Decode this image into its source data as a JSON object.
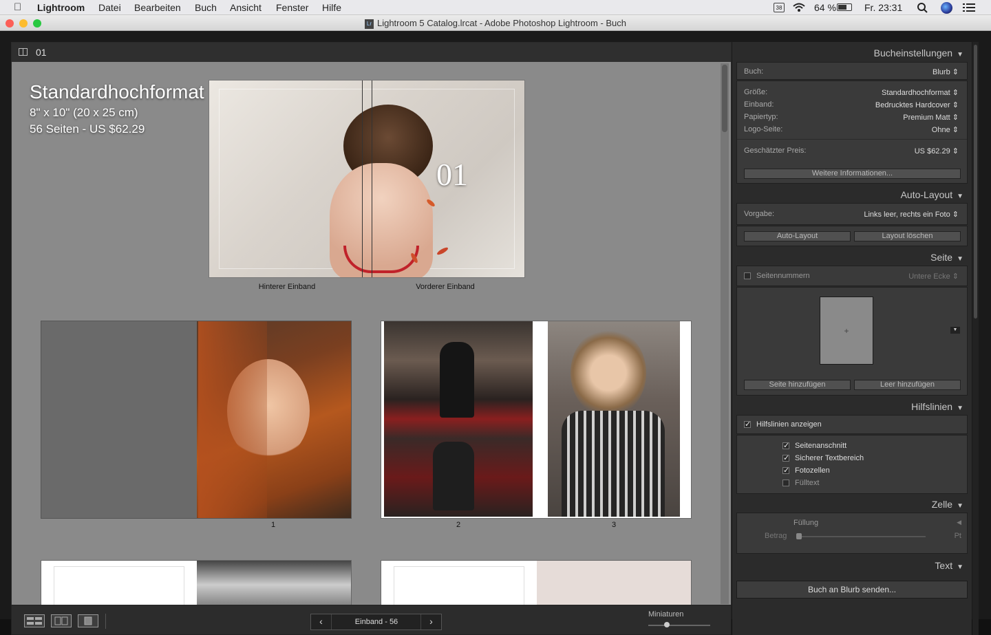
{
  "menubar": {
    "app": "Lightroom",
    "items": [
      "Datei",
      "Bearbeiten",
      "Buch",
      "Ansicht",
      "Fenster",
      "Hilfe"
    ],
    "calendar_day": "38",
    "battery": "64 %",
    "clock": "Fr. 23:31"
  },
  "window": {
    "title": "Lightroom 5 Catalog.lrcat - Adobe Photoshop Lightroom - Buch"
  },
  "canvas": {
    "header_page": "01",
    "overlay_title": "Standardhochformat",
    "overlay_size": "8\" x 10\" (20 x 25 cm)",
    "overlay_pages": "56 Seiten - US $62.29",
    "cover_number": "01",
    "back_cover_label": "Hinterer Einband",
    "front_cover_label": "Vorderer Einband",
    "page_labels": [
      "1",
      "2",
      "3"
    ]
  },
  "bottombar": {
    "nav_label": "Einband - 56",
    "thumb_label": "Miniaturen"
  },
  "panel": {
    "book_settings": {
      "title": "Bucheinstellungen",
      "book_label": "Buch:",
      "book_value": "Blurb",
      "size_label": "Größe:",
      "size_value": "Standardhochformat",
      "cover_label": "Einband:",
      "cover_value": "Bedrucktes Hardcover",
      "paper_label": "Papiertyp:",
      "paper_value": "Premium Matt",
      "logo_label": "Logo-Seite:",
      "logo_value": "Ohne",
      "price_label": "Geschätzter Preis:",
      "price_value": "US $62.29",
      "more_info": "Weitere Informationen..."
    },
    "auto_layout": {
      "title": "Auto-Layout",
      "preset_label": "Vorgabe:",
      "preset_value": "Links leer, rechts ein Foto",
      "auto_btn": "Auto-Layout",
      "clear_btn": "Layout löschen"
    },
    "page": {
      "title": "Seite",
      "page_numbers": "Seitennummern",
      "page_numbers_pos": "Untere Ecke",
      "add_page": "Seite hinzufügen",
      "add_blank": "Leer hinzufügen",
      "thumb_plus": "+"
    },
    "guides": {
      "title": "Hilfslinien",
      "show": "Hilfslinien anzeigen",
      "trim": "Seitenanschnitt",
      "safe": "Sicherer Textbereich",
      "cells": "Fotozellen",
      "filler": "Fülltext"
    },
    "cell": {
      "title": "Zelle",
      "padding": "Füllung",
      "amount": "Betrag",
      "unit": "Pt"
    },
    "text": {
      "title": "Text"
    },
    "send": "Buch an Blurb senden..."
  }
}
